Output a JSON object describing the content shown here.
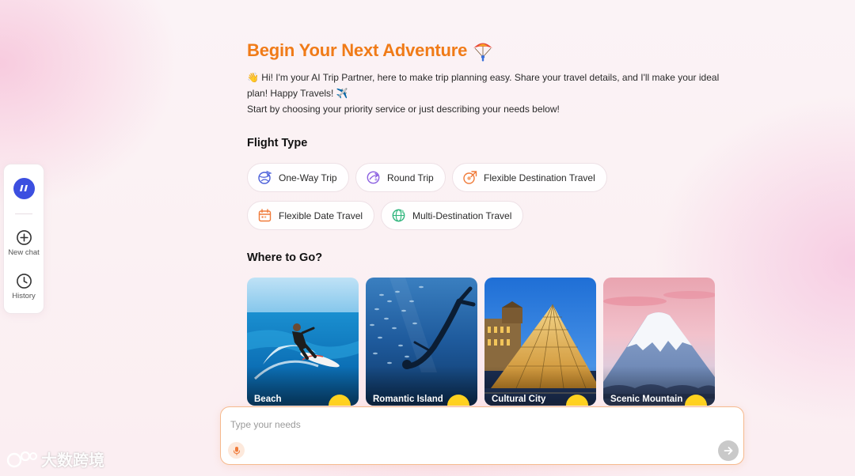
{
  "sidebar": {
    "logo_icon": "quote-icon",
    "items": [
      {
        "label": "New chat",
        "icon": "plus-circle-icon"
      },
      {
        "label": "History",
        "icon": "clock-icon"
      }
    ]
  },
  "header": {
    "title": "Begin Your Next Adventure",
    "title_icon": "paraglider-icon",
    "title_color": "#f07b18"
  },
  "intro": {
    "line1": "👋 Hi! I'm your AI Trip Partner, here to make trip planning easy. Share your travel details, and I'll make your ideal plan! Happy Travels! ✈️",
    "line2": "Start by choosing your priority service or just describing your needs below!"
  },
  "flight_type": {
    "title": "Flight Type",
    "options": [
      {
        "label": "One-Way Trip",
        "icon": "globe-plane-icon",
        "color": "#4b5fd9"
      },
      {
        "label": "Round Trip",
        "icon": "round-trip-icon",
        "color": "#8b5fe0"
      },
      {
        "label": "Flexible Destination Travel",
        "icon": "flexible-destination-icon",
        "color": "#f07b3a"
      },
      {
        "label": "Flexible Date Travel",
        "icon": "calendar-icon",
        "color": "#f07b3a"
      },
      {
        "label": "Multi-Destination Travel",
        "icon": "globe-icon",
        "color": "#2fb57c"
      }
    ]
  },
  "destinations": {
    "title": "Where to Go?",
    "cards": [
      {
        "label": "Beach"
      },
      {
        "label": "Romantic Island"
      },
      {
        "label": "Cultural City"
      },
      {
        "label": "Scenic Mountain"
      }
    ]
  },
  "chat_input": {
    "placeholder": "Type your needs",
    "border_color": "#f6b98d"
  },
  "watermark": {
    "text": "大数跨境"
  }
}
